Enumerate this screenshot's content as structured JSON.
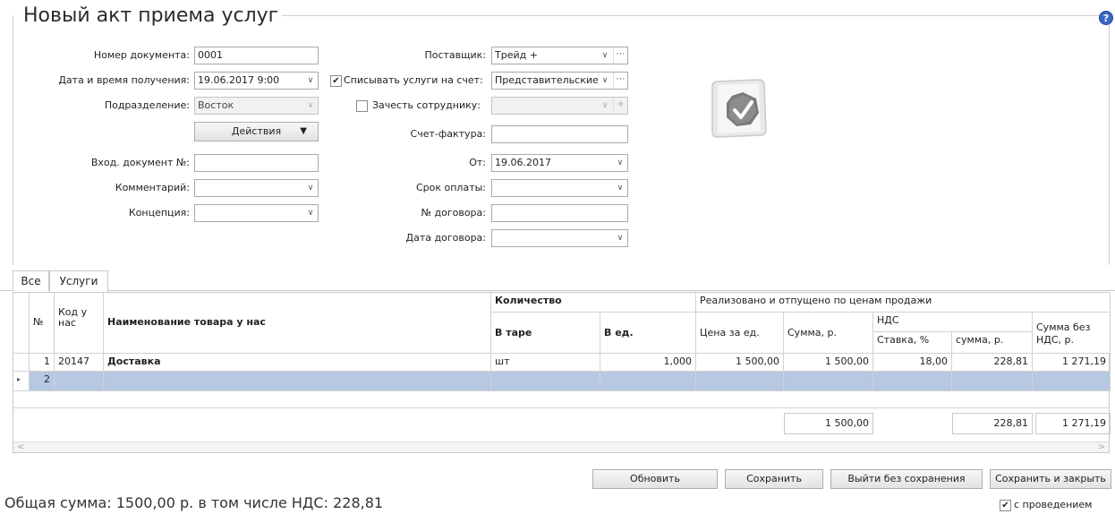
{
  "window": {
    "title": "Новый акт приема услуг"
  },
  "form": {
    "doc_number_label": "Номер документа:",
    "doc_number_value": "0001",
    "datetime_label": "Дата и время получения:",
    "datetime_value": "19.06.2017 9:00",
    "department_label": "Подразделение:",
    "department_value": "Восток",
    "actions_label": "Действия",
    "in_doc_label": "Вход. документ №:",
    "in_doc_value": "",
    "comment_label": "Комментарий:",
    "comment_value": "",
    "concept_label": "Концепция:",
    "concept_value": "",
    "supplier_label": "Поставщик:",
    "supplier_value": "Трейд +",
    "writeoff_label": "Списывать услуги на счет:",
    "writeoff_checked": true,
    "writeoff_value": "Представительские",
    "employee_label": "Зачесть сотруднику:",
    "employee_checked": false,
    "employee_value": "",
    "invoice_label": "Счет-фактура:",
    "invoice_value": "",
    "from_label": "От:",
    "from_value": "19.06.2017",
    "payment_term_label": "Срок оплаты:",
    "payment_term_value": "",
    "contract_no_label": "№ договора:",
    "contract_no_value": "",
    "contract_date_label": "Дата договора:",
    "contract_date_value": ""
  },
  "tabs": [
    {
      "label": "Все",
      "selected": false
    },
    {
      "label": "Услуги",
      "selected": true
    }
  ],
  "table": {
    "headers": {
      "num": "№",
      "code": "Код у нас",
      "name": "Наименование товара у нас",
      "qty_group": "Количество",
      "in_tare": "В таре",
      "in_units": "В ед.",
      "sold_group": "Реализовано и отпущено по ценам продажи",
      "price": "Цена за ед.",
      "sum": "Сумма, р.",
      "vat_group": "НДС",
      "vat_rate": "Ставка, %",
      "vat_sum": "сумма, р.",
      "sum_no_vat": "Сумма без НДС, р."
    },
    "rows": [
      {
        "num": "1",
        "code": "20147",
        "name": "Доставка",
        "in_tare": "шт",
        "in_units": "1,000",
        "price": "1 500,00",
        "sum": "1 500,00",
        "vat_rate": "18,00",
        "vat_sum": "228,81",
        "sum_no_vat": "1 271,19"
      },
      {
        "num": "2",
        "code": "",
        "name": "",
        "in_tare": "",
        "in_units": "",
        "price": "",
        "sum": "",
        "vat_rate": "",
        "vat_sum": "",
        "sum_no_vat": ""
      }
    ],
    "totals": {
      "sum": "1 500,00",
      "vat_sum": "228,81",
      "sum_no_vat": "1 271,19"
    }
  },
  "buttons": {
    "refresh": "Обновить",
    "save": "Сохранить",
    "exit_no_save": "Выйти без сохранения",
    "save_close": "Сохранить и закрыть"
  },
  "post_checkbox_label": "с проведением",
  "post_checkbox_checked": true,
  "footer": {
    "total_text": "Общая сумма: 1500,00 р. в том числе НДС: 228,81"
  }
}
